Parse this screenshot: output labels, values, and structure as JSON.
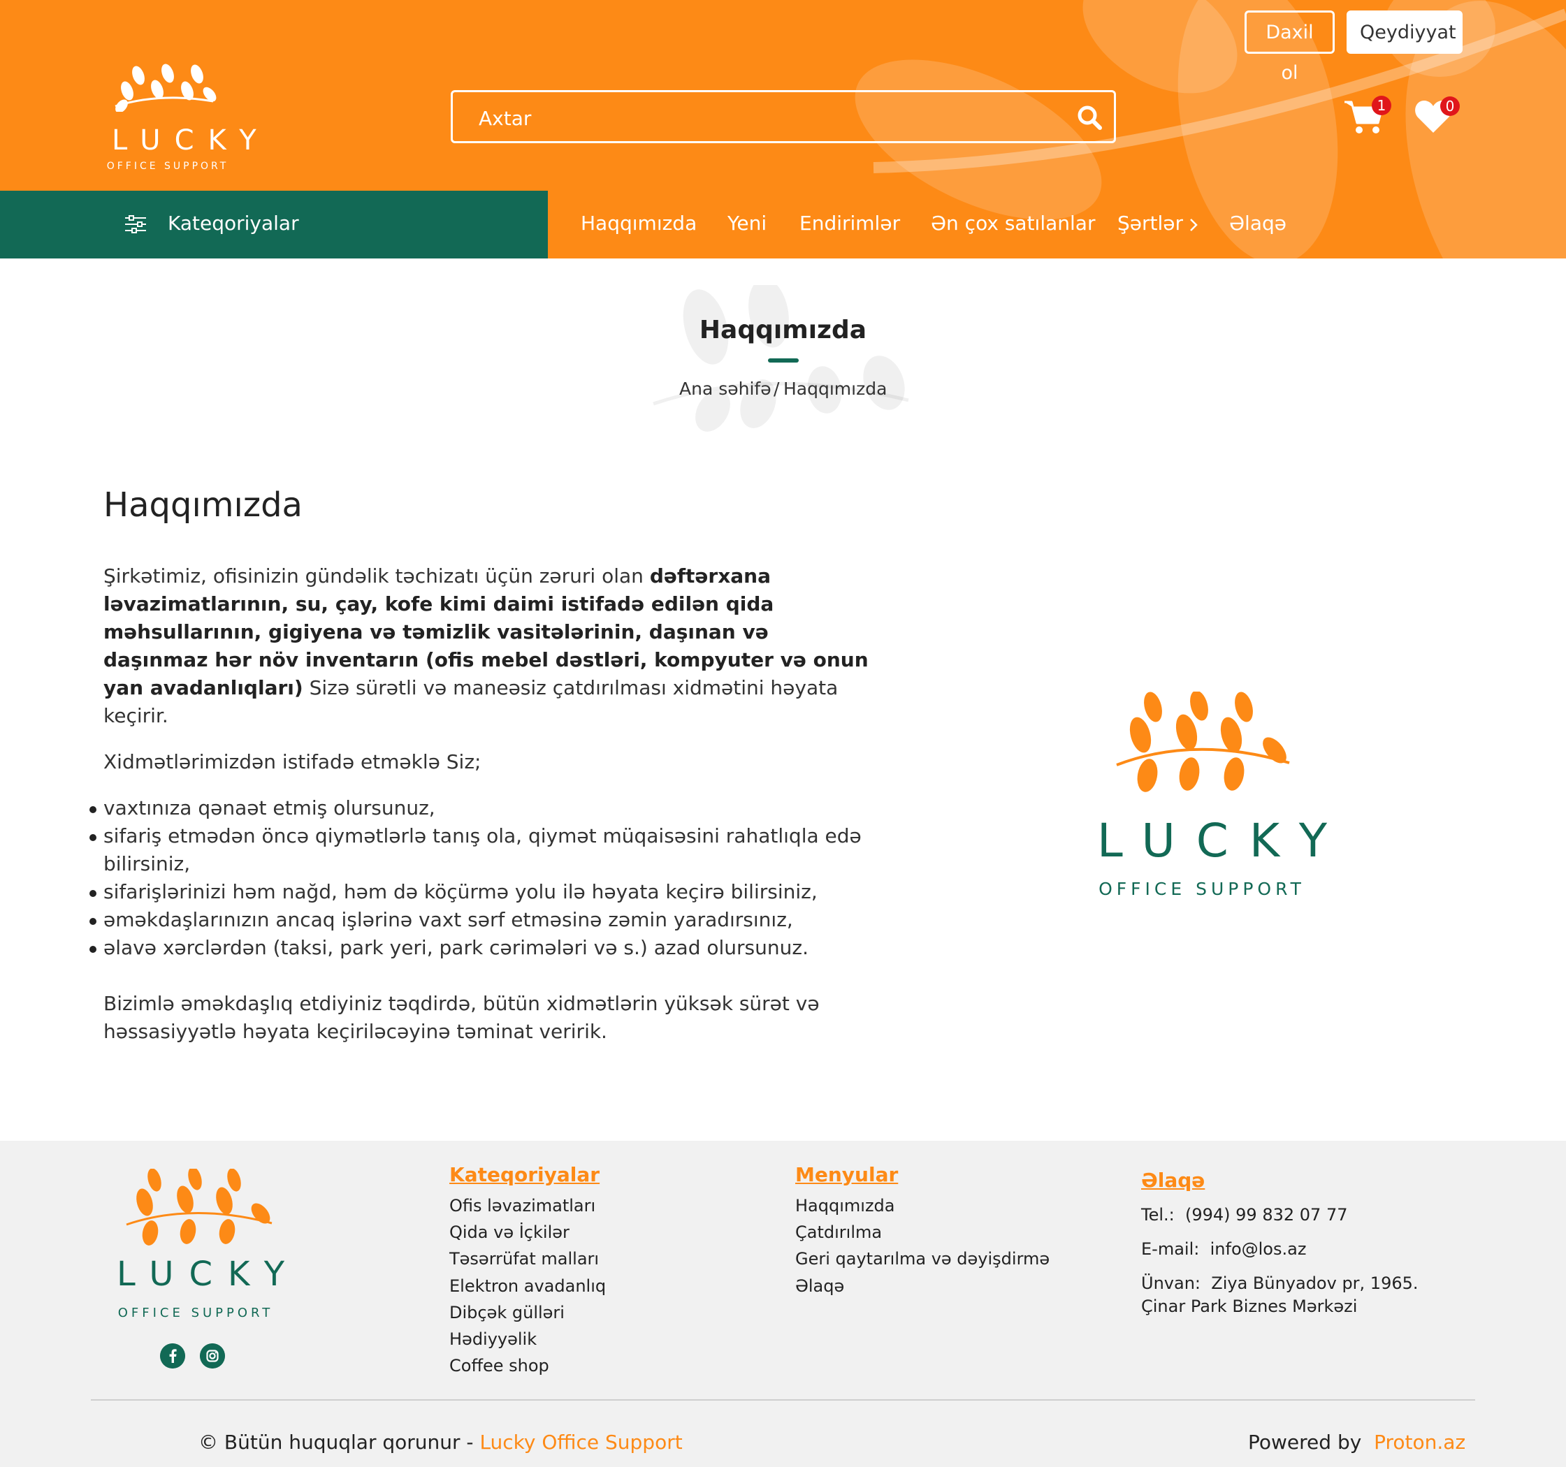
{
  "header": {
    "logo": {
      "name": "LUCKY",
      "tagline": "OFFICE SUPPORT"
    },
    "login_label": "Daxil ol",
    "register_label": "Qeydiyyat",
    "search": {
      "placeholder": "Axtar"
    },
    "cart_count": "1",
    "wishlist_count": "0"
  },
  "nav": {
    "categories_label": "Kateqoriyalar",
    "items": [
      {
        "label": "Haqqımızda"
      },
      {
        "label": "Yeni"
      },
      {
        "label": "Endirimlər"
      },
      {
        "label": "Ən çox satılanlar"
      },
      {
        "label": "Şərtlər"
      },
      {
        "label": "Əlaqə"
      }
    ]
  },
  "page_title": {
    "title": "Haqqımızda",
    "breadcrumb_home": "Ana səhifə",
    "breadcrumb_sep": "/",
    "breadcrumb_current": "Haqqımızda"
  },
  "content": {
    "title": "Haqqımızda",
    "intro_start": "Şirkətimiz, ofisinizin gündəlik təchizatı üçün zəruri olan ",
    "intro_bold": "dəftərxana ləvazimatlarının, su, çay, kofe kimi daimi istifadə edilən qida məhsullarının, gigiyena və təmizlik vasitələrinin, daşınan və daşınmaz hər növ inventarın (ofis mebel dəstləri, kompyuter və onun yan avadanlıqları)",
    "intro_end": " Sizə sürətli və maneəsiz çatdırılması xidmətini həyata keçirir.",
    "lead": "Xidmətlərimizdən istifadə etməklə Siz;",
    "benefits": [
      "vaxtınıza qənaət etmiş olursunuz,",
      "sifariş etmədən öncə qiymətlərlə tanış ola, qiymət müqaisəsini rahatlıqla edə bilirsiniz,",
      "sifarişlərinizi həm nağd, həm də köçürmə yolu ilə həyata keçirə bilirsiniz,",
      "əməkdaşlarınızın ancaq işlərinə vaxt sərf etməsinə zəmin yaradırsınız,",
      "əlavə xərclərdən (taksi, park yeri, park cərimələri və s.) azad olursunuz."
    ],
    "closing": "Bizimlə əməkdaşlıq etdiyiniz təqdirdə, bütün xidmətlərin yüksək sürət və həssasiyyətlə həyata keçiriləcəyinə təminat veririk."
  },
  "footer": {
    "logo": {
      "name": "LUCKY",
      "tagline": "OFFICE SUPPORT"
    },
    "categories": {
      "title": "Kateqoriyalar",
      "links": [
        "Ofis ləvazimatları",
        "Qida və İçkilər",
        "Təsərrüfat malları",
        "Elektron avadanlıq",
        "Dibçək gülləri",
        "Hədiyyəlik",
        "Coffee shop"
      ]
    },
    "menus": {
      "title": "Menyular",
      "links": [
        "Haqqımızda",
        "Çatdırılma",
        "Geri qaytarılma və dəyişdirmə",
        "Əlaqə"
      ]
    },
    "contact": {
      "title": "Əlaqə",
      "phone_label": "Tel.:",
      "phone": "(994) 99 832 07 77",
      "email_label": "E-mail:",
      "email": "info@los.az",
      "address_label": "Ünvan:",
      "address": "Ziya Bünyadov pr, 1965. Çinar Park Biznes Mərkəzi"
    },
    "copyright_prefix": "© Bütün huquqlar qorunur - ",
    "copyright_brand": "Lucky Office Support",
    "powered_prefix": "Powered by",
    "powered_brand": "Proton.az"
  },
  "colors": {
    "brand_orange": "#fd8a16",
    "brand_green": "#126955",
    "badge_red": "#e0161b",
    "footer_bg": "#f1f1f1"
  }
}
